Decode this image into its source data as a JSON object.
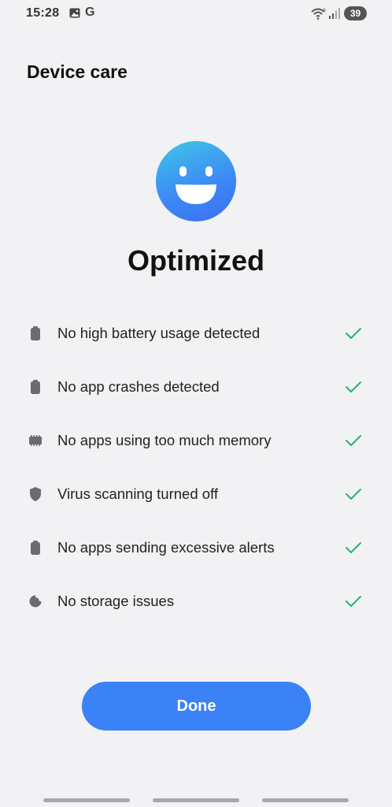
{
  "status_bar": {
    "time": "15:28",
    "g_label": "G",
    "battery": "39"
  },
  "header": {
    "title": "Device care"
  },
  "main": {
    "status_heading": "Optimized",
    "checks": [
      {
        "label": "No high battery usage detected",
        "icon": "battery-icon"
      },
      {
        "label": "No app crashes detected",
        "icon": "battery-icon"
      },
      {
        "label": "No apps using too much memory",
        "icon": "memory-chip-icon"
      },
      {
        "label": "Virus scanning turned off",
        "icon": "shield-icon"
      },
      {
        "label": "No apps sending excessive alerts",
        "icon": "battery-icon"
      },
      {
        "label": "No storage issues",
        "icon": "pie-chart-icon"
      }
    ],
    "done_label": "Done"
  },
  "colors": {
    "accent": "#3b82f6",
    "check_green": "#27b07a",
    "icon_gray": "#6b6b70"
  }
}
